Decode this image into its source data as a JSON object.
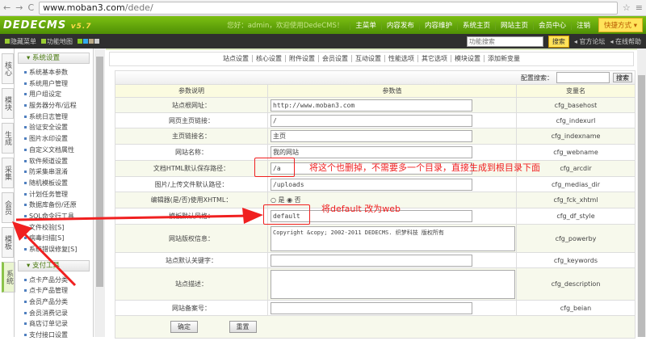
{
  "browser": {
    "url_host": "www.moban3.com",
    "url_path": "/dede/"
  },
  "header": {
    "logo": "DEDECMS",
    "version": "v5.7",
    "greeting": "您好：admin，欢迎使用DedeCMS！",
    "nav": [
      "主菜单",
      "内容发布",
      "内容维护",
      "系统主页",
      "网站主页",
      "会员中心",
      "注销"
    ],
    "quick": "快捷方式 ▾"
  },
  "toolbar": {
    "hide_menu": "隐藏菜单",
    "function_map": "功能地图",
    "search_placeholder": "功能搜索",
    "search_btn": "搜索",
    "forum": "官方论坛",
    "help": "在线帮助"
  },
  "tabs": [
    "核心",
    "模块",
    "生成",
    "采集",
    "会员",
    "模板",
    "系统"
  ],
  "menu": {
    "group1": "系统设置",
    "items1": [
      "系统基本参数",
      "系统用户管理",
      "用户组设定",
      "服务器分布/远程",
      "系统日志管理",
      "验证安全设置",
      "图片水印设置",
      "自定义文档属性",
      "软件频道设置",
      "防采集串混淆",
      "随机模板设置",
      "计划任务管理",
      "数据库备份/还原",
      "SQL命令行工具",
      "文件校验[S]",
      "病毒扫描[S]",
      "系统错误修复[S]"
    ],
    "group2": "支付工具",
    "items2": [
      "点卡产品分类",
      "点卡产品管理",
      "会员产品分类",
      "会员消费记录",
      "商店订单记录",
      "支付接口设置"
    ]
  },
  "subnav": [
    "站点设置",
    "核心设置",
    "附件设置",
    "会员设置",
    "互动设置",
    "性能选项",
    "其它选项",
    "模块设置",
    "添加新变量"
  ],
  "config_search": {
    "label": "配置搜索：",
    "btn": "搜索"
  },
  "table": {
    "headers": [
      "参数说明",
      "参数值",
      "变量名"
    ],
    "rows": [
      {
        "label": "站点根网址：",
        "value": "http://www.moban3.com",
        "var": "cfg_basehost"
      },
      {
        "label": "网页主页链接：",
        "value": "/",
        "var": "cfg_indexurl"
      },
      {
        "label": "主页链接名：",
        "value": "主页",
        "var": "cfg_indexname"
      },
      {
        "label": "网站名称：",
        "value": "我的网站",
        "var": "cfg_webname"
      },
      {
        "label": "文档HTML默认保存路径：",
        "value": "/a",
        "var": "cfg_arcdir"
      },
      {
        "label": "图片/上传文件默认路径：",
        "value": "/uploads",
        "var": "cfg_medias_dir"
      },
      {
        "label": "编辑器(是/否)使用XHTML：",
        "yes": "是",
        "no": "否",
        "var": "cfg_fck_xhtml"
      },
      {
        "label": "模板默认风格：",
        "value": "default",
        "var": "cfg_df_style"
      },
      {
        "label": "网站版权信息：",
        "value": "Copyright &copy; 2002-2011 DEDECMS. 织梦科技 版权所有",
        "var": "cfg_powerby"
      },
      {
        "label": "站点默认关键字：",
        "value": "",
        "var": "cfg_keywords"
      },
      {
        "label": "站点描述：",
        "value": "",
        "var": "cfg_description"
      },
      {
        "label": "网站备案号：",
        "value": "",
        "var": "cfg_beian"
      }
    ]
  },
  "buttons": {
    "ok": "确定",
    "reset": "重置"
  },
  "annotations": {
    "note1": "将这个也删掉，不需要多一个目录，直接生成到根目录下面",
    "note2": "将default 改为web"
  }
}
